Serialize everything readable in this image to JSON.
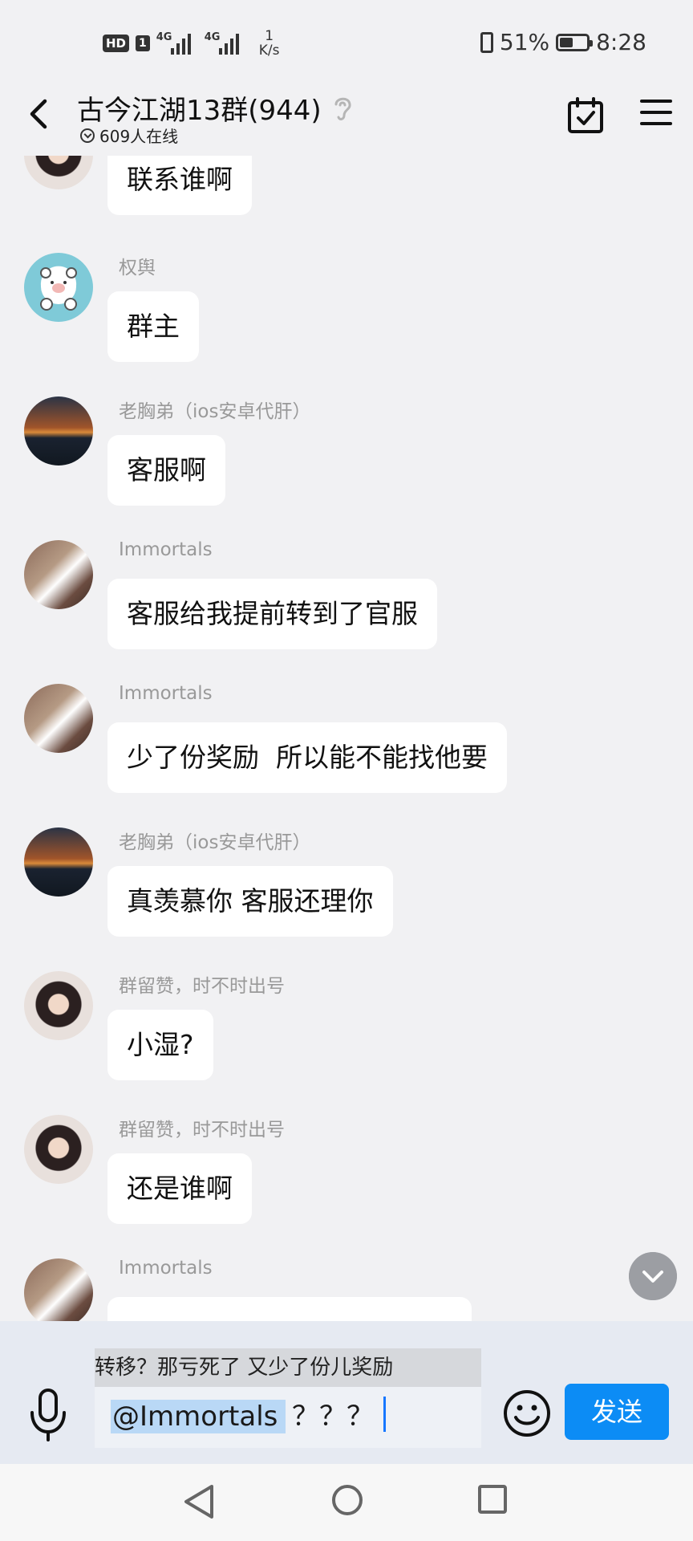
{
  "status_bar": {
    "hd": "HD",
    "sim": "1",
    "net1": "4G",
    "net2": "4G",
    "speed_value": "1",
    "speed_unit": "K/s",
    "battery_text": "51%",
    "battery_level": 0.51,
    "time": "8:28"
  },
  "header": {
    "title": "古今江湖13群(944)",
    "online": "609人在线"
  },
  "messages": [
    {
      "sender": "",
      "text": "联系谁啊",
      "avatar": "anime-icon"
    },
    {
      "sender": "权舆",
      "text": "群主",
      "avatar": "bear-icon"
    },
    {
      "sender": "老胸弟（ios安卓代肝）",
      "text": "客服啊",
      "avatar": "sunset-icon"
    },
    {
      "sender": "Immortals",
      "text": "客服给我提前转到了官服",
      "avatar": "cat-icon"
    },
    {
      "sender": "Immortals",
      "text": "少了份奖励  所以能不能找他要",
      "avatar": "cat-icon"
    },
    {
      "sender": "老胸弟（ios安卓代肝）",
      "text": "真羡慕你 客服还理你",
      "avatar": "sunset-icon"
    },
    {
      "sender": "群留赞，时不时出号",
      "text": "小湿?",
      "avatar": "anime-icon"
    },
    {
      "sender": "群留赞，时不时出号",
      "text": "还是谁啊",
      "avatar": "anime-icon"
    },
    {
      "sender": "Immortals",
      "text": "",
      "avatar": "cat-icon"
    }
  ],
  "input": {
    "quote": "转移？那亏死了  又少了份儿奖励",
    "mention": "@Immortals",
    "typed": "？？？",
    "send_label": "发送"
  },
  "colors": {
    "accent": "#0c8cf5",
    "background": "#f1f1f3",
    "bubble": "#ffffff"
  }
}
